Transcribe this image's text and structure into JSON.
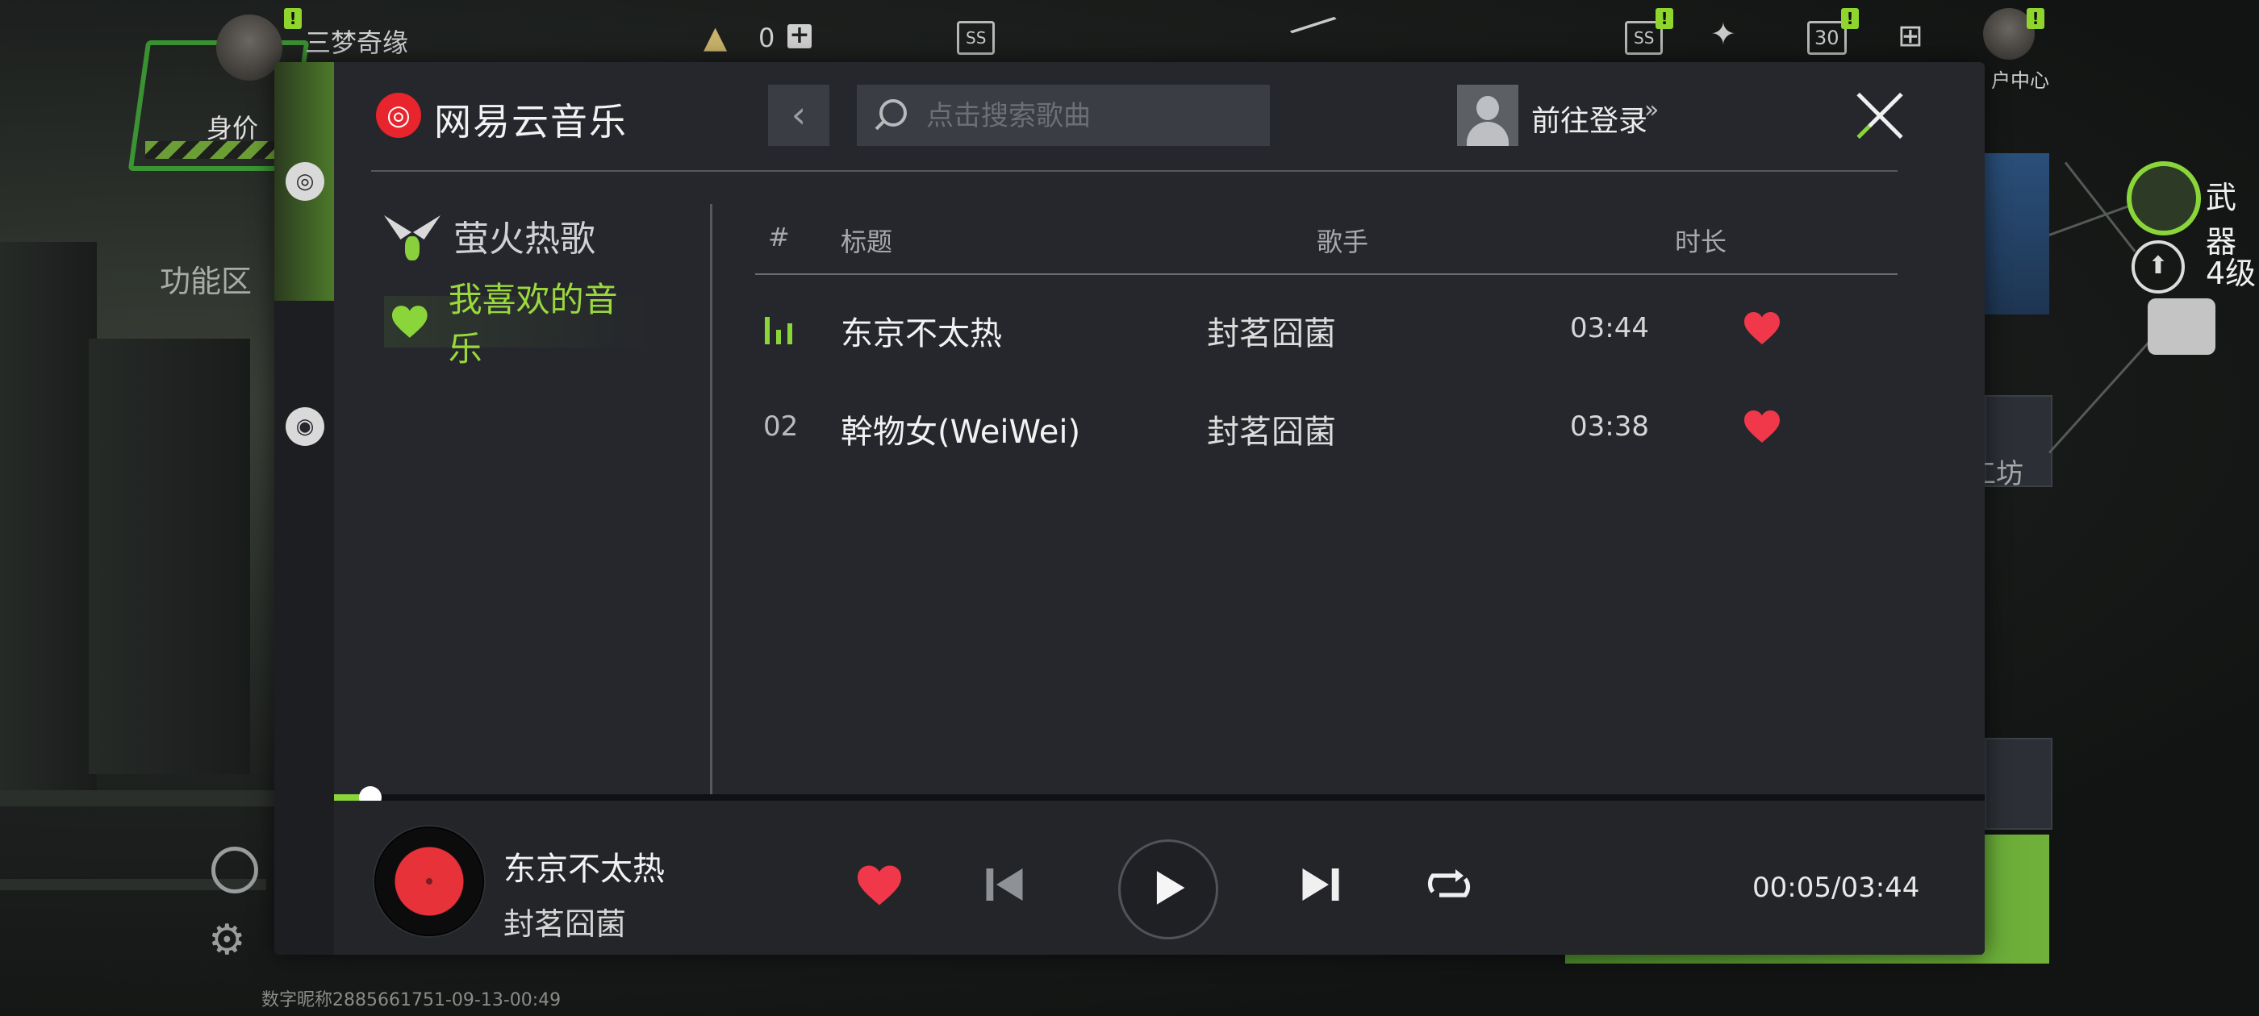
{
  "hud": {
    "player_name": "三梦奇缘",
    "currency_amount": "0",
    "pass_label": "SS",
    "calendar_day": "30",
    "user_center": "户中心",
    "badge_mark": "!"
  },
  "side": {
    "status_label": "身价",
    "function_area": "功能区",
    "weapon_label": "武器",
    "level_label": "4级",
    "workshop_label": "工坊",
    "watermark": "数字昵称2885661751-09-13-00:49"
  },
  "music": {
    "app_name": "网易云音乐",
    "search_placeholder": "点击搜索歌曲",
    "login_label": "前往登录",
    "login_chevron": "»",
    "nav": {
      "hot_songs": "萤火热歌",
      "my_favorites": "我喜欢的音乐"
    },
    "table": {
      "headers": {
        "num": "#",
        "title": "标题",
        "artist": "歌手",
        "duration": "时长"
      },
      "rows": [
        {
          "num": "",
          "playing": true,
          "title": "东京不太热",
          "artist": "封茗囧菌",
          "duration": "03:44",
          "liked": true
        },
        {
          "num": "02",
          "playing": false,
          "title": "幹物女(WeiWei)",
          "artist": "封茗囧菌",
          "duration": "03:38",
          "liked": true
        }
      ]
    },
    "player": {
      "now_title": "东京不太热",
      "now_artist": "封茗囧菌",
      "time_display": "00:05/03:44",
      "progress_fraction": 0.022
    },
    "colors": {
      "accent_green": "#8ad63a",
      "heart_red": "#f0384a",
      "logo_red": "#e8242d"
    }
  },
  "icons": {
    "close": "close-icon",
    "back": "chevron-left-icon",
    "search": "search-icon",
    "heart": "heart-icon",
    "prev": "skip-previous-icon",
    "play": "play-icon",
    "next": "skip-next-icon",
    "repeat": "repeat-icon",
    "settings": "gear-icon"
  }
}
